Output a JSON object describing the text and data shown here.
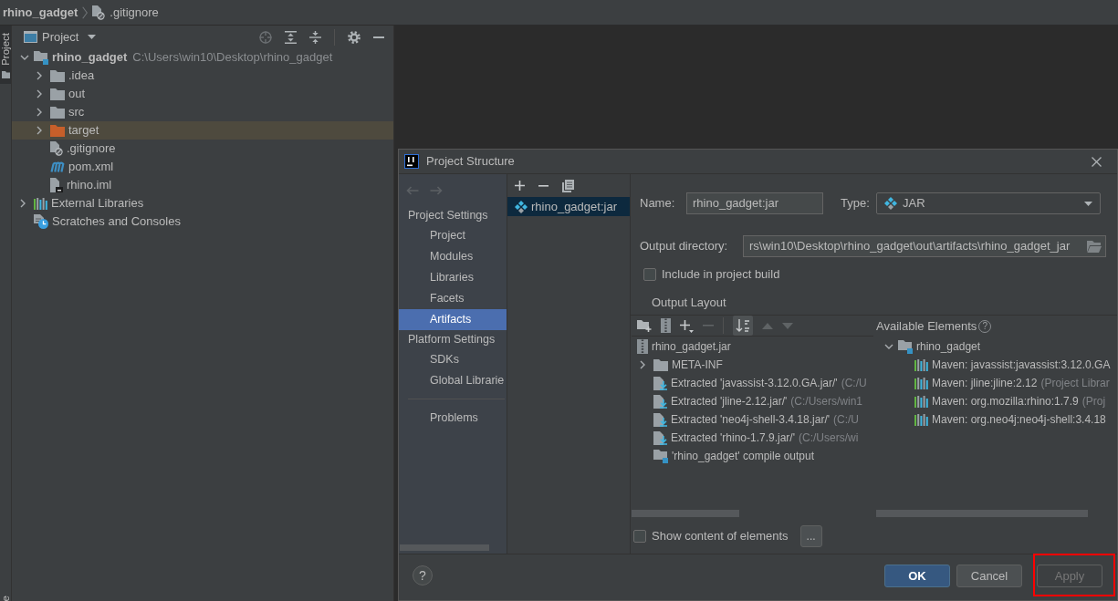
{
  "breadcrumbs": [
    {
      "label": "rhino_gadget",
      "kind": "project"
    },
    {
      "label": ".gitignore",
      "kind": "gitignore"
    }
  ],
  "tool_stripe": {
    "top_tabs": [
      {
        "label": "Project",
        "selected": true
      }
    ],
    "bottom_tabs": [
      {
        "label": "e",
        "selected": false
      }
    ]
  },
  "project_panel": {
    "title": "Project",
    "tree": [
      {
        "label": "rhino_gadget",
        "path": "C:\\Users\\win10\\Desktop\\rhino_gadget",
        "kind": "module",
        "expanded": true,
        "selected": false,
        "children": [
          {
            "label": ".idea",
            "kind": "folder",
            "expanded": false,
            "selected": false
          },
          {
            "label": "out",
            "kind": "folder",
            "expanded": false,
            "selected": false
          },
          {
            "label": "src",
            "kind": "folder",
            "expanded": false,
            "selected": false
          },
          {
            "label": "target",
            "kind": "excluded",
            "expanded": false,
            "selected": true
          },
          {
            "label": ".gitignore",
            "kind": "gitignore",
            "selected": false
          },
          {
            "label": "pom.xml",
            "kind": "maven",
            "selected": false
          },
          {
            "label": "rhino.iml",
            "kind": "iml",
            "selected": false
          }
        ]
      },
      {
        "label": "External Libraries",
        "kind": "libraries",
        "expanded": false,
        "selected": false
      },
      {
        "label": "Scratches and Consoles",
        "kind": "scratches",
        "selected": false
      }
    ]
  },
  "dialog": {
    "title": "Project Structure",
    "history": [
      {
        "kind": "back",
        "disabled": true
      },
      {
        "kind": "forward",
        "disabled": true
      }
    ],
    "nav": [
      {
        "header": "Project Settings",
        "items": [
          {
            "label": "Project",
            "selected": false
          },
          {
            "label": "Modules",
            "selected": false
          },
          {
            "label": "Libraries",
            "selected": false
          },
          {
            "label": "Facets",
            "selected": false
          },
          {
            "label": "Artifacts",
            "selected": true
          }
        ]
      },
      {
        "header": "Platform Settings",
        "items": [
          {
            "label": "SDKs",
            "selected": false
          },
          {
            "label": "Global Librarie",
            "selected": false
          }
        ]
      },
      {
        "items": [
          {
            "label": "Problems",
            "selected": false
          }
        ]
      }
    ],
    "artifacts": [
      {
        "label": "rhino_gadget:jar",
        "selected": true
      }
    ],
    "name": {
      "label": "Name:",
      "value": "rhino_gadget:jar"
    },
    "type": {
      "label": "Type:",
      "value": "JAR"
    },
    "output_directory": {
      "label": "Output directory:",
      "value": "rs\\win10\\Desktop\\rhino_gadget\\out\\artifacts\\rhino_gadget_jar"
    },
    "include_in_build": {
      "label": "Include in project build",
      "checked": false
    },
    "output_layout": {
      "title": "Output Layout",
      "toolbar": [
        {
          "kind": "new_folder",
          "disabled": false,
          "on": false
        },
        {
          "kind": "archive",
          "disabled": false,
          "on": false
        },
        {
          "kind": "add",
          "disabled": false,
          "on": false
        },
        {
          "kind": "remove",
          "disabled": true,
          "on": false
        },
        {
          "kind": "sort",
          "disabled": false,
          "on": true
        },
        {
          "kind": "move_up",
          "disabled": true,
          "on": false
        },
        {
          "kind": "move_down",
          "disabled": true,
          "on": false
        }
      ],
      "tree": [
        {
          "label": "rhino_gadget.jar",
          "kind": "jar",
          "children": [
            {
              "label": "META-INF",
              "kind": "folder",
              "expanded": false
            },
            {
              "label": "Extracted 'javassist-3.12.0.GA.jar/'",
              "detail": "(C:/U",
              "kind": "extracted"
            },
            {
              "label": "Extracted 'jline-2.12.jar/'",
              "detail": "(C:/Users/win1",
              "kind": "extracted"
            },
            {
              "label": "Extracted 'neo4j-shell-3.4.18.jar/'",
              "detail": "(C:/U",
              "kind": "extracted"
            },
            {
              "label": "Extracted 'rhino-1.7.9.jar/'",
              "detail": "(C:/Users/wi",
              "kind": "extracted"
            },
            {
              "label": "'rhino_gadget' compile output",
              "kind": "output"
            }
          ]
        }
      ]
    },
    "available_elements": {
      "title": "Available Elements",
      "help": "?",
      "tree": [
        {
          "label": "rhino_gadget",
          "kind": "module",
          "expanded": true,
          "children": [
            {
              "label": "Maven: javassist:javassist:3.12.0.GA",
              "kind": "library"
            },
            {
              "label": "Maven: jline:jline:2.12",
              "detail": "(Project Librar",
              "kind": "library"
            },
            {
              "label": "Maven: org.mozilla:rhino:1.7.9",
              "detail": "(Proj",
              "kind": "library"
            },
            {
              "label": "Maven: org.neo4j:neo4j-shell:3.4.18",
              "kind": "library"
            }
          ]
        }
      ]
    },
    "show_content": {
      "label": "Show content of elements",
      "checked": false
    },
    "more_button": "...",
    "help_button": "?",
    "buttons": [
      {
        "label": "OK",
        "kind": "default",
        "disabled": false,
        "annotated": false
      },
      {
        "label": "Cancel",
        "kind": "normal",
        "disabled": false,
        "annotated": false
      },
      {
        "label": "Apply",
        "kind": "normal",
        "disabled": true,
        "annotated": true
      }
    ]
  }
}
